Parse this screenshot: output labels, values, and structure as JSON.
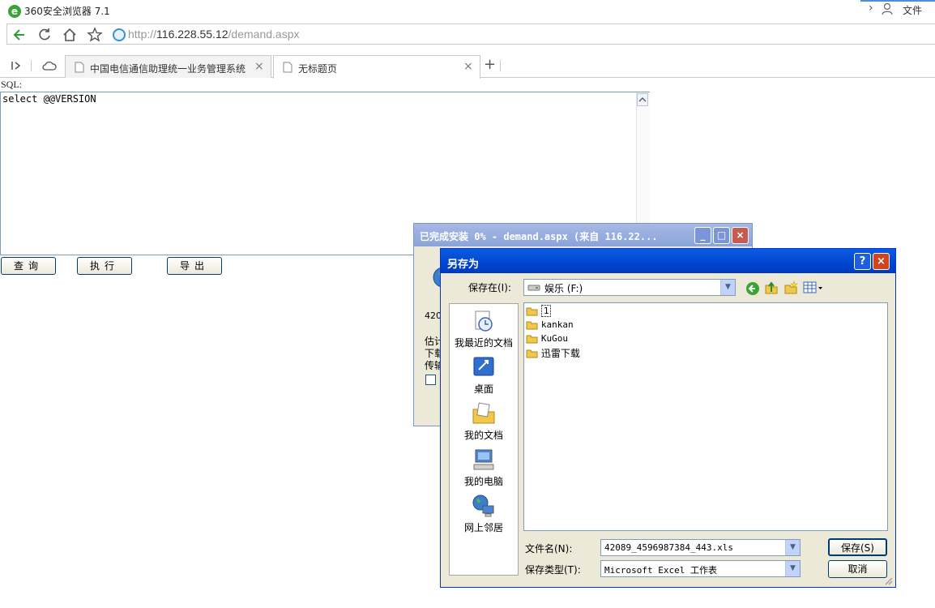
{
  "browser": {
    "title": "360安全浏览器 7.1",
    "file_menu": "文件",
    "address": {
      "scheme": "http://",
      "host": "116.228.55.12",
      "path": "/demand.aspx"
    },
    "tabs": [
      {
        "label": "中国电信通信助理统一业务管理系统",
        "active": false
      },
      {
        "label": "无标题页",
        "active": true
      }
    ],
    "new_tab": "+"
  },
  "page": {
    "sql_label": "SQL:",
    "sql_text": "select @@VERSION",
    "buttons": {
      "query": "查询",
      "execute": "执行",
      "export": "导出"
    }
  },
  "download_dialog": {
    "title": "已完成安装 0% - demand.aspx (来自 116.22...",
    "partial_text": [
      "420",
      "估计",
      "下载",
      "传输"
    ]
  },
  "save_dialog": {
    "title": "另存为",
    "save_in_label": "保存在(I):",
    "save_in_value": "娱乐 (F:)",
    "places": [
      {
        "label": "我最近的文档",
        "icon": "recent-documents-icon"
      },
      {
        "label": "桌面",
        "icon": "desktop-icon"
      },
      {
        "label": "我的文档",
        "icon": "my-documents-icon"
      },
      {
        "label": "我的电脑",
        "icon": "my-computer-icon"
      },
      {
        "label": "网上邻居",
        "icon": "network-places-icon"
      }
    ],
    "files": [
      "1",
      "kankan",
      "KuGou",
      "迅雷下载"
    ],
    "filename_label": "文件名(N):",
    "filename_value": "42089_4596987384_443.xls",
    "filetype_label": "保存类型(T):",
    "filetype_value": "Microsoft Excel 工作表",
    "save_button": "保存(S)",
    "cancel_button": "取消"
  },
  "colors": {
    "xp_blue": "#0045cf",
    "accent_green": "#3aa336",
    "close_red": "#d4431f"
  }
}
